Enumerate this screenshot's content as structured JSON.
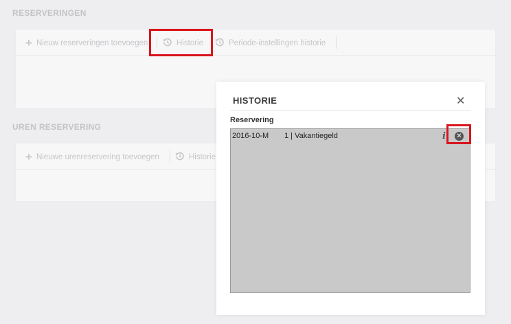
{
  "sections": {
    "reserveringen": {
      "title": "RESERVERINGEN",
      "toolbar": {
        "new_label": "Nieuw reserveringen toevoegen",
        "history_label": "Historie",
        "period_history_label": "Periode-instellingen historie"
      }
    },
    "uren": {
      "title": "UREN RESERVERING",
      "toolbar": {
        "new_label": "Nieuwe urenreservering toevoegen",
        "history_label": "Historie"
      }
    }
  },
  "modal": {
    "title": "HISTORIE",
    "close_glyph": "✕",
    "list_label": "Reservering",
    "rows": [
      {
        "period": "2016-10-M",
        "description": "1 | Vakantiegeld",
        "info_glyph": "i",
        "remove_glyph": "✕"
      }
    ]
  },
  "icons": {
    "plus": "plus-icon",
    "history": "history-icon",
    "info": "info-icon",
    "remove": "remove-circle-icon"
  },
  "colors": {
    "highlight": "#d9141c",
    "list_background": "#c9c9c9"
  }
}
